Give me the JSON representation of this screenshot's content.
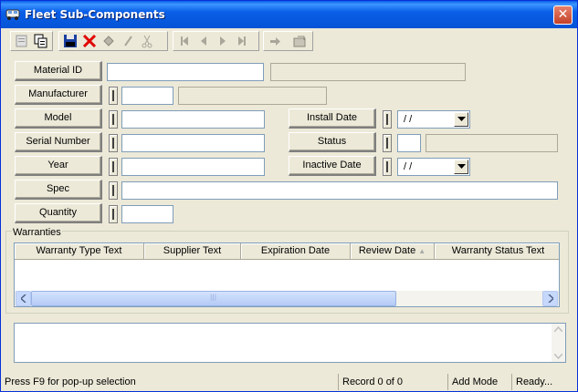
{
  "window": {
    "title": "Fleet Sub-Components",
    "close_glyph": "✕"
  },
  "toolbar": {
    "buttons": [
      {
        "name": "properties-button",
        "icon": "properties-icon"
      },
      {
        "name": "copy-button",
        "icon": "copy-icon"
      },
      {
        "name": "save-button",
        "icon": "save-icon"
      },
      {
        "name": "delete-button",
        "icon": "delete-icon"
      },
      {
        "name": "stamp-button",
        "icon": "stamp-icon"
      },
      {
        "name": "edit-button",
        "icon": "pencil-icon"
      },
      {
        "name": "cut-button",
        "icon": "scissors-icon"
      },
      {
        "name": "first-record-button",
        "icon": "first-icon"
      },
      {
        "name": "previous-record-button",
        "icon": "previous-icon"
      },
      {
        "name": "next-record-button",
        "icon": "next-icon"
      },
      {
        "name": "last-record-button",
        "icon": "last-icon"
      },
      {
        "name": "go-button",
        "icon": "arrow-right-icon"
      },
      {
        "name": "export-button",
        "icon": "export-icon"
      }
    ]
  },
  "form": {
    "material_id": {
      "label": "Material ID",
      "value": "",
      "description": ""
    },
    "manufacturer": {
      "label": "Manufacturer",
      "value": "",
      "description": ""
    },
    "model": {
      "label": "Model",
      "value": ""
    },
    "serial_number": {
      "label": "Serial Number",
      "value": ""
    },
    "year": {
      "label": "Year",
      "value": ""
    },
    "spec": {
      "label": "Spec",
      "value": ""
    },
    "quantity": {
      "label": "Quantity",
      "value": ""
    },
    "install_date": {
      "label": "Install Date",
      "value": "/  /"
    },
    "status": {
      "label": "Status",
      "value": "",
      "description": ""
    },
    "inactive_date": {
      "label": "Inactive Date",
      "value": "/  /"
    }
  },
  "warranties": {
    "label": "Warranties",
    "columns": [
      "Warranty Type Text",
      "Supplier Text",
      "Expiration Date",
      "Review Date",
      "Warranty Status Text"
    ],
    "sort_glyph": "▲",
    "grip": "|||",
    "rows": []
  },
  "memo": {
    "value": ""
  },
  "status_bar": {
    "hint": "Press F9 for pop-up selection",
    "record": "Record 0 of 0",
    "mode": "Add Mode",
    "state": "Ready..."
  },
  "colors": {
    "title_bar": "#0a5fe8",
    "delete_red": "#e00000",
    "window_bg": "#ece9d8"
  }
}
